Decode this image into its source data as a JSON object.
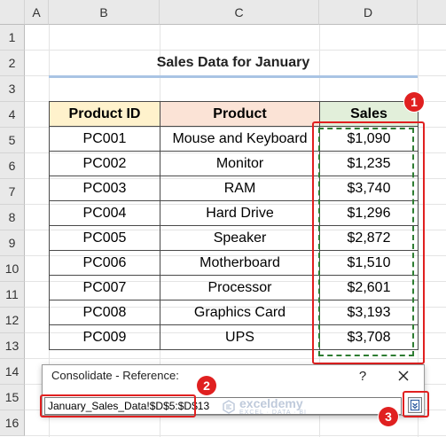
{
  "columns": [
    "A",
    "B",
    "C",
    "D"
  ],
  "rows": [
    "1",
    "2",
    "3",
    "4",
    "5",
    "6",
    "7",
    "8",
    "9",
    "10",
    "11",
    "12",
    "13",
    "14",
    "15",
    "16"
  ],
  "sheet": {
    "title": "Sales Data for January",
    "headers": [
      "Product ID",
      "Product",
      "Sales"
    ],
    "records": [
      [
        "PC001",
        "Mouse and Keyboard",
        "$1,090"
      ],
      [
        "PC002",
        "Monitor",
        "$1,235"
      ],
      [
        "PC003",
        "RAM",
        "$3,740"
      ],
      [
        "PC004",
        "Hard Drive",
        "$1,296"
      ],
      [
        "PC005",
        "Speaker",
        "$2,872"
      ],
      [
        "PC006",
        "Motherboard",
        "$1,510"
      ],
      [
        "PC007",
        "Processor",
        "$2,601"
      ],
      [
        "PC008",
        "Graphics Card",
        "$3,193"
      ],
      [
        "PC009",
        "UPS",
        "$3,708"
      ]
    ]
  },
  "dialog": {
    "title": "Consolidate - Reference:",
    "help": "?",
    "reference_value": "January_Sales_Data!$D$5:$D$13"
  },
  "callouts": [
    "1",
    "2",
    "3"
  ],
  "watermark": {
    "name": "exceldemy",
    "tagline": "EXCEL · DATA · BI"
  },
  "colors": {
    "accent_red": "#e02020",
    "marquee_green": "#2e7d32",
    "header_id": "#fff2cc",
    "header_product": "#fbe3d6",
    "header_sales": "#e2efda",
    "title_underline": "#a9c4e4"
  }
}
